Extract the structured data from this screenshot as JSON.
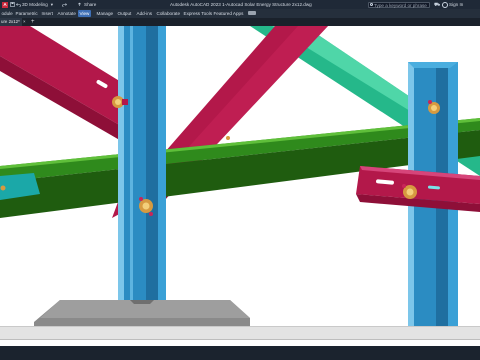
{
  "app": {
    "logo": "A",
    "workspace": "3D Modeling",
    "share": "Share",
    "title": "Autodesk AutoCAD 2023   1-Autocad Solar Energy Structure 2x12.dwg",
    "search_placeholder": "Type a keyword or phrase",
    "sign_in": "Sign In"
  },
  "ribbon": {
    "tabs": [
      "odule",
      "Parametric",
      "Insert",
      "Annotate",
      "View",
      "Manage",
      "Output",
      "Add-ins",
      "Collaborate",
      "Express Tools",
      "Featured Apps"
    ],
    "active_tab": "View"
  },
  "file_tabs": {
    "active": "ure 2x12*",
    "close": "×",
    "add": "+"
  },
  "colors": {
    "red_beam": "#b3184a",
    "green_rail": "#2d7d1c",
    "teal_beam": "#25b88a",
    "blue_post": "#2b8cc2",
    "concrete": "#8a8a8a",
    "bolt": "#d69a40"
  },
  "icons": [
    "autocad-logo-icon",
    "save-icon",
    "undo-icon",
    "redo-icon",
    "share-icon",
    "search-icon",
    "cart-icon",
    "user-icon"
  ]
}
